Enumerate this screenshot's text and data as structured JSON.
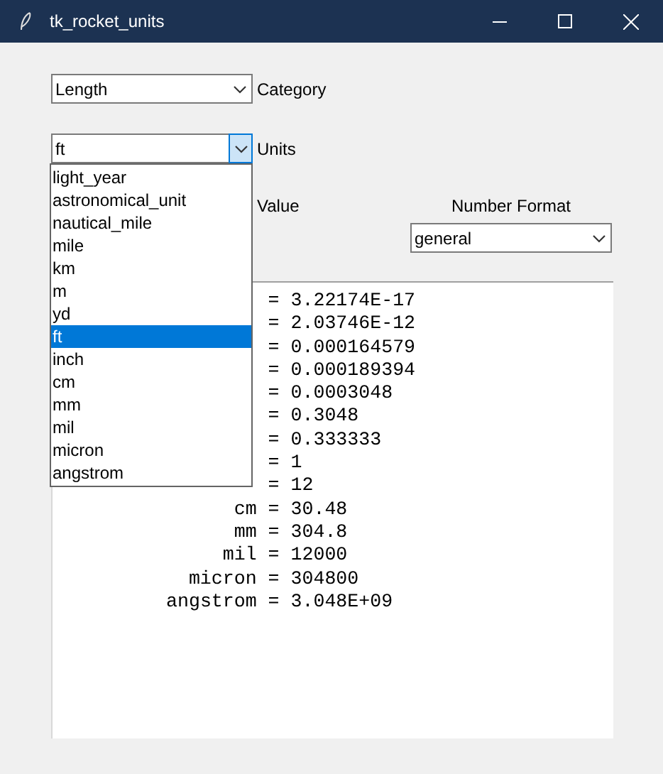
{
  "window": {
    "title": "tk_rocket_units"
  },
  "category": {
    "value": "Length",
    "label": "Category"
  },
  "units": {
    "value": "ft",
    "label": "Units",
    "expanded": true,
    "options": [
      {
        "label": "light_year",
        "selected": false
      },
      {
        "label": "astronomical_unit",
        "selected": false
      },
      {
        "label": "nautical_mile",
        "selected": false
      },
      {
        "label": "mile",
        "selected": false
      },
      {
        "label": "km",
        "selected": false
      },
      {
        "label": "m",
        "selected": false
      },
      {
        "label": "yd",
        "selected": false
      },
      {
        "label": "ft",
        "selected": true
      },
      {
        "label": "inch",
        "selected": false
      },
      {
        "label": "cm",
        "selected": false
      },
      {
        "label": "mm",
        "selected": false
      },
      {
        "label": "mil",
        "selected": false
      },
      {
        "label": "micron",
        "selected": false
      },
      {
        "label": "angstrom",
        "selected": false
      }
    ]
  },
  "value_label": "Value",
  "number_format": {
    "label": "Number Format",
    "value": "general"
  },
  "results": [
    {
      "text": "= 3.22174E-17"
    },
    {
      "text": "= 2.03746E-12"
    },
    {
      "text": "= 0.000164579"
    },
    {
      "text": "= 0.000189394"
    },
    {
      "text": "= 0.0003048"
    },
    {
      "text": "= 0.3048"
    },
    {
      "text": "= 0.333333"
    },
    {
      "text": "= 1"
    },
    {
      "text": "= 12"
    },
    {
      "unit": "cm",
      "text": "= 30.48"
    },
    {
      "unit": "mm",
      "text": "= 304.8"
    },
    {
      "unit": "mil",
      "text": "= 12000"
    },
    {
      "unit": "micron",
      "text": "= 304800"
    },
    {
      "unit": "angstrom",
      "text": "= 3.048E+09"
    }
  ]
}
